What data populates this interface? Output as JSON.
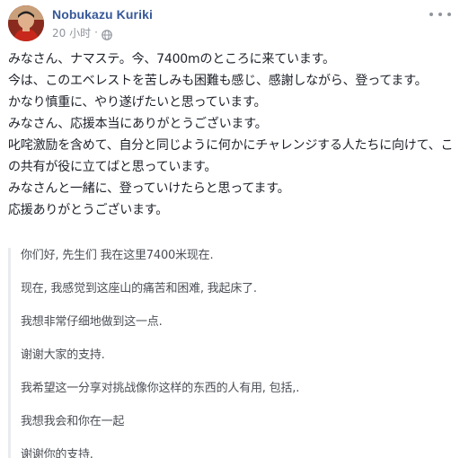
{
  "post": {
    "author": "Nobukazu Kuriki",
    "timestamp": "20 小时",
    "separator": "·",
    "privacy_icon": "globe-icon",
    "more_icon": "ellipsis-icon",
    "lines": [
      "みなさん、ナマステ。今、7400mのところに来ています。",
      "今は、このエベレストを苦しみも困難も感じ、感謝しながら、登ってます。",
      "かなり慎重に、やり遂げたいと思っています。",
      "みなさん、応援本当にありがとうございます。",
      "叱咤激励を含めて、自分と同じように何かにチャレンジする人たちに向けて、この共有が役に立てばと思っています。",
      "みなさんと一緒に、登っていけたらと思ってます。",
      "応援ありがとうございます。"
    ]
  },
  "translation": {
    "lines": [
      "你们好, 先生们 我在这里7400米现在.",
      "现在, 我感觉到这座山的痛苦和困难, 我起床了.",
      "我想非常仔细地做到这一点.",
      "谢谢大家的支持.",
      "我希望这一分享对挑战像你这样的东西的人有用, 包括,.",
      "我想我会和你在一起",
      "谢谢你的支持."
    ]
  },
  "colors": {
    "author_link": "#365899",
    "meta_text": "#90949c",
    "body_text": "#1d2129",
    "translation_text": "#4b4f56",
    "translation_border": "#e9ebee"
  }
}
